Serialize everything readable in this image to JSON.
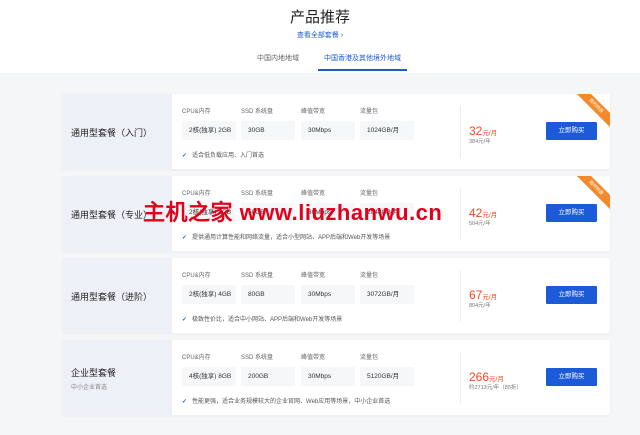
{
  "header": {
    "title": "产品推荐",
    "view_all": "查看全部套餐",
    "tabs": [
      {
        "label": "中国内地地域"
      },
      {
        "label": "中国香港及其他境外地域"
      }
    ]
  },
  "spec_labels": [
    "CPU&内存",
    "SSD 系统盘",
    "峰值带宽",
    "流量包"
  ],
  "buy_label": "立即购买",
  "ribbon_label": "限时特惠",
  "plans": [
    {
      "name": "通用型套餐（入门）",
      "sub": "",
      "specs": [
        "2核(独享) 2GB",
        "30GB",
        "30Mbps",
        "1024GB/月"
      ],
      "feature": "适合低负载应用、入门首选",
      "price_num": "32",
      "price_unit": "元/月",
      "original": "384元/年"
    },
    {
      "name": "通用型套餐（专业）",
      "sub": "",
      "specs": [
        "2核(独享) 4GB",
        "50GB",
        "30Mbps",
        "2048GB/月"
      ],
      "feature": "提供通用计算性能和网络流量，适合小型网站、APP后端和Web开发等场景",
      "price_num": "42",
      "price_unit": "元/月",
      "original": "504元/年"
    },
    {
      "name": "通用型套餐（进阶）",
      "sub": "",
      "specs": [
        "2核(独享) 4GB",
        "80GB",
        "30Mbps",
        "3072GB/月"
      ],
      "feature": "极致性价比，适合中小网站、APP后端和Web开发等场景",
      "price_num": "67",
      "price_unit": "元/月",
      "original": "804元/年"
    },
    {
      "name": "企业型套餐",
      "sub": "中小企业首选",
      "specs": [
        "4核(独享) 8GB",
        "200GB",
        "30Mbps",
        "5120GB/月"
      ],
      "feature": "性能更强，适合业务规模较大的企业官网、Web应用等场景，中小企业首选",
      "price_num": "266",
      "price_unit": "元/月",
      "original": "约2713元/年（85折）"
    }
  ],
  "watermark": "主机之家 www.liuzhanwu.cn",
  "colors": {
    "accent": "#1c5ad8",
    "price": "#f04a1c",
    "ribbon": "#f28a2c",
    "watermark": "#e2001a"
  }
}
